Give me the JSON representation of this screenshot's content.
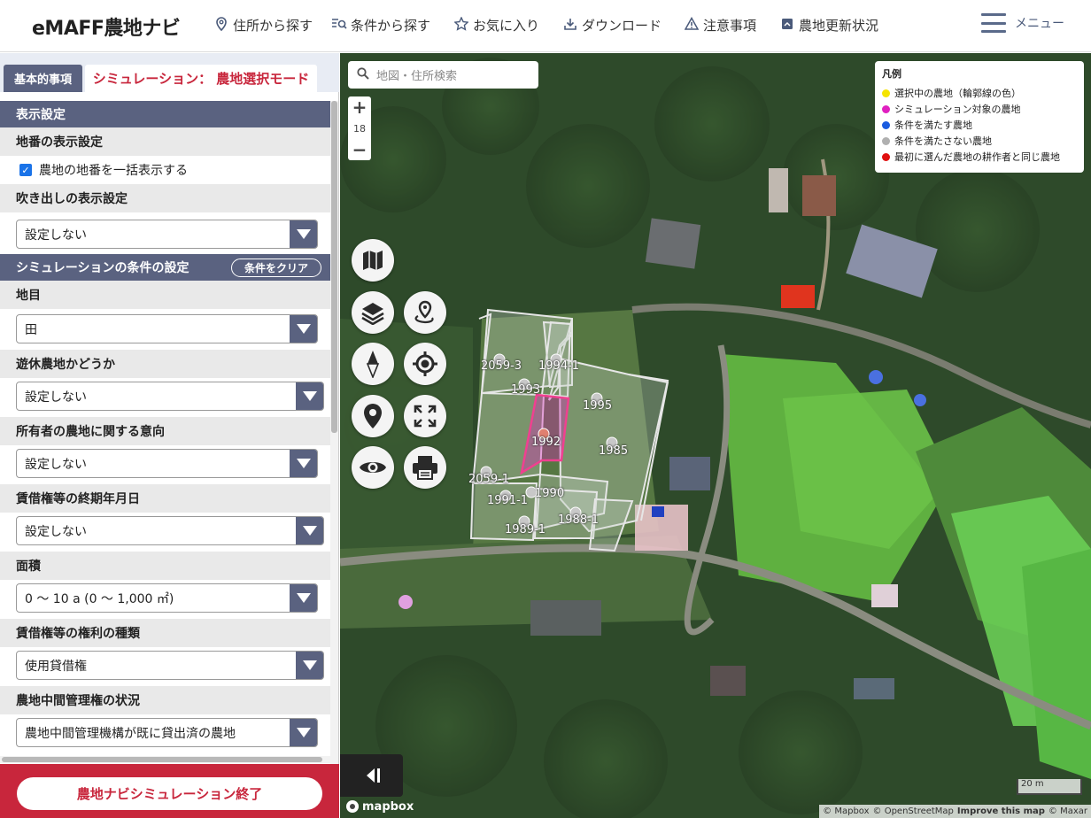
{
  "header": {
    "logo": "eMAFF農地ナビ",
    "nav": [
      {
        "icon": "location-pin-icon",
        "label": "住所から探す"
      },
      {
        "icon": "filter-search-icon",
        "label": "条件から探す"
      },
      {
        "icon": "star-icon",
        "label": "お気に入り"
      },
      {
        "icon": "download-icon",
        "label": "ダウンロード"
      },
      {
        "icon": "warning-icon",
        "label": "注意事項"
      },
      {
        "icon": "update-icon",
        "label": "農地更新状況"
      }
    ],
    "menu_label": "メニュー"
  },
  "sidebar": {
    "tab_basic": "基本的事項",
    "tab_sim": "シミュレーション： 農地選択モード",
    "display_settings": {
      "title": "表示設定",
      "lot_number_label": "地番の表示設定",
      "lot_number_checkbox": "農地の地番を一括表示する",
      "balloon_label": "吹き出しの表示設定",
      "balloon_value": "設定しない"
    },
    "conditions": {
      "title": "シミュレーションの条件の設定",
      "clear_label": "条件をクリア",
      "fields": [
        {
          "label": "地目",
          "value": "田"
        },
        {
          "label": "遊休農地かどうか",
          "value": "設定しない"
        },
        {
          "label": "所有者の農地に関する意向",
          "value": "設定しない"
        },
        {
          "label": "賃借権等の終期年月日",
          "value": "設定しない"
        },
        {
          "label": "面積",
          "value": "0 ～ 10 a (0 ～ 1,000 ㎡)"
        },
        {
          "label": "賃借権等の権利の種類",
          "value": "使用貸借権"
        },
        {
          "label": "農地中間管理権の状況",
          "value": "農地中間管理機構が既に貸出済の農地"
        }
      ]
    },
    "end_button": "農地ナビシミュレーション終了"
  },
  "map": {
    "search_placeholder": "地図・住所検索",
    "zoom_level": "18",
    "zoom_in": "+",
    "zoom_out": "−",
    "legend": {
      "title": "凡例",
      "items": [
        {
          "label": "選択中の農地（輪郭線の色）",
          "color": "#f5e400"
        },
        {
          "label": "シミュレーション対象の農地",
          "color": "#e020c0"
        },
        {
          "label": "条件を満たす農地",
          "color": "#1a5be0"
        },
        {
          "label": "条件を満たさない農地",
          "color": "#b0b0b0"
        },
        {
          "label": "最初に選んだ農地の耕作者と同じ農地",
          "color": "#e01010"
        }
      ]
    },
    "plots": [
      "2059-3",
      "1994-1",
      "1993",
      "1995",
      "1992",
      "1985",
      "2059-1",
      "1990",
      "1991-1",
      "1988-1",
      "1989-1"
    ],
    "scale": "20 m",
    "mapbox": "mapbox",
    "attribution": {
      "mapbox": "© Mapbox",
      "osm": "© OpenStreetMap",
      "improve": "Improve this map",
      "maxar": "© Maxar"
    }
  }
}
